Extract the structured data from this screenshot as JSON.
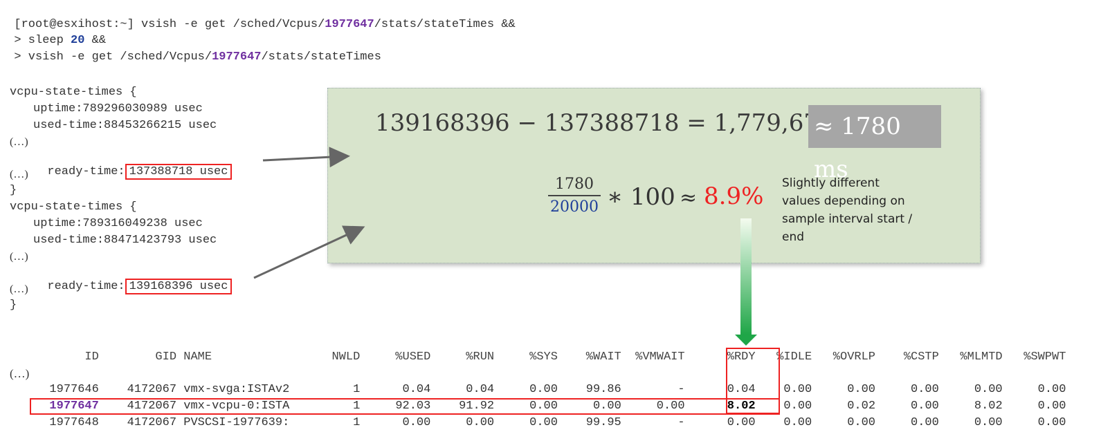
{
  "terminal": {
    "line1_prefix": "[root@esxihost:~] vsish -e get /sched/Vcpus/",
    "vcpu_id": "1977647",
    "line1_suffix": "/stats/stateTimes &&",
    "line2_prefix": "> sleep ",
    "sleep_value": "20",
    "line2_suffix": " &&",
    "line3_prefix": "> vsish -e get /sched/Vcpus/",
    "line3_suffix": "/stats/stateTimes"
  },
  "state_times": {
    "block1": {
      "header": "vcpu-state-times {",
      "uptime": "uptime:789296030989 usec",
      "used_time": "used-time:88453266215 usec",
      "ellipsis": "(…)",
      "ready_label": "ready-time:",
      "ready_value": "137388718 usec",
      "close": "}"
    },
    "block2": {
      "header": "vcpu-state-times {",
      "uptime": "uptime:789316049238 usec",
      "used_time": "used-time:88471423793 usec",
      "ellipsis": "(…)",
      "ready_label": "ready-time:",
      "ready_value": "139168396 usec",
      "close": "}"
    }
  },
  "calc": {
    "equation": "139168396  −  137388718 = 1,779,678",
    "approx_ms": "≈ 1780 ms",
    "frac_num": "1780",
    "frac_den": "20000",
    "times": "∗ 100",
    "approx": "≈",
    "percent": "8.9%",
    "note": "Slightly different values depending on sample interval start / end"
  },
  "esxtop": {
    "headers": [
      "ID",
      "GID",
      "NAME",
      "NWLD",
      "%USED",
      "%RUN",
      "%SYS",
      "%WAIT",
      "%VMWAIT",
      "%RDY",
      "%IDLE",
      "%OVRLP",
      "%CSTP",
      "%MLMTD",
      "%SWPWT"
    ],
    "ellipsis": "(…)",
    "rows": [
      [
        "1977646",
        "4172067",
        "vmx-svga:ISTAv2",
        "1",
        "0.04",
        "0.04",
        "0.00",
        "99.86",
        "-",
        "0.04",
        "0.00",
        "0.00",
        "0.00",
        "0.00",
        "0.00"
      ],
      [
        "1977647",
        "4172067",
        "vmx-vcpu-0:ISTA",
        "1",
        "92.03",
        "91.92",
        "0.00",
        "0.00",
        "0.00",
        "8.02",
        "0.00",
        "0.02",
        "0.00",
        "8.02",
        "0.00"
      ],
      [
        "1977648",
        "4172067",
        "PVSCSI-1977639:",
        "1",
        "0.00",
        "0.00",
        "0.00",
        "99.95",
        "-",
        "0.00",
        "0.00",
        "0.00",
        "0.00",
        "0.00",
        "0.00"
      ]
    ]
  },
  "colors": {
    "highlight_red": "#ee2222",
    "vcpu_purple": "#7030a0",
    "panel_green": "#d8e4cc",
    "arrow_green": "#22aa44"
  }
}
